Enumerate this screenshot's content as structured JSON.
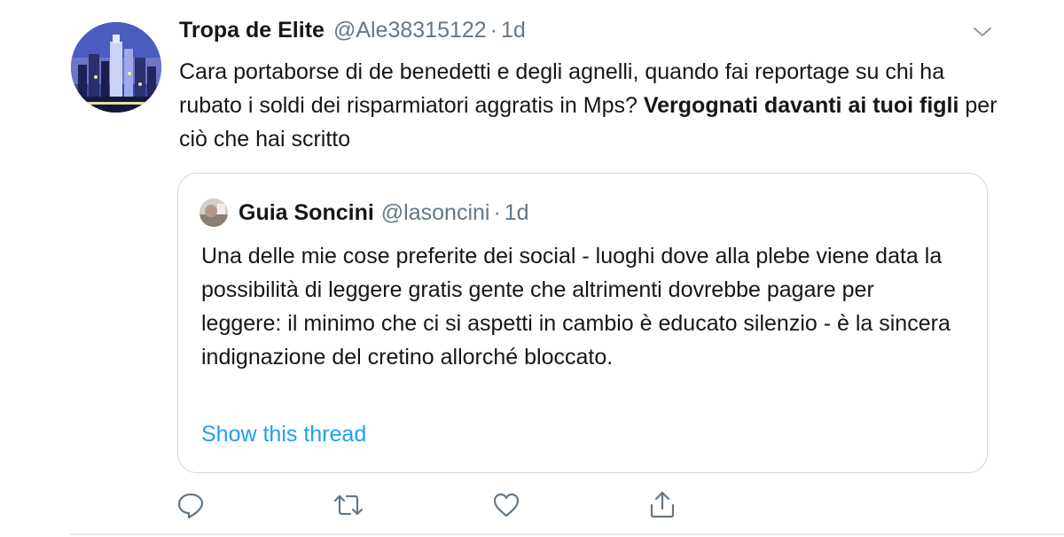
{
  "tweet": {
    "display_name": "Tropa de Elite",
    "handle": "@Ale38315122",
    "separator": "·",
    "time": "1d",
    "text_parts": [
      "Cara portaborse di de benedetti e degli agnelli, quando fai reportage su chi ha rubato i soldi dei risparmiatori aggratis in Mps? ",
      "Vergognati davanti ai tuoi figli",
      " per ciò che hai scritto"
    ],
    "avatar_icon": "city-skyline-photo",
    "menu_icon": "chevron-down-icon"
  },
  "quoted_tweet": {
    "display_name": "Guia Soncini",
    "handle": "@lasoncini",
    "separator": "·",
    "time": "1d",
    "text": "Una delle mie cose preferite dei social - luoghi dove alla plebe viene data la possibilità di leggere gratis gente che altrimenti dovrebbe pagare per leggere: il minimo che ci si aspetti in cambio è educato silenzio - è la sincera indignazione del cretino allorché bloccato.",
    "show_thread": "Show this thread"
  },
  "actions": [
    {
      "name": "reply",
      "icon": "reply-icon"
    },
    {
      "name": "retweet",
      "icon": "retweet-icon"
    },
    {
      "name": "like",
      "icon": "heart-icon"
    },
    {
      "name": "share",
      "icon": "share-icon"
    }
  ],
  "colors": {
    "text": "#14171a",
    "secondary": "#657786",
    "link": "#1da1f2",
    "border": "#ccd6dd"
  }
}
